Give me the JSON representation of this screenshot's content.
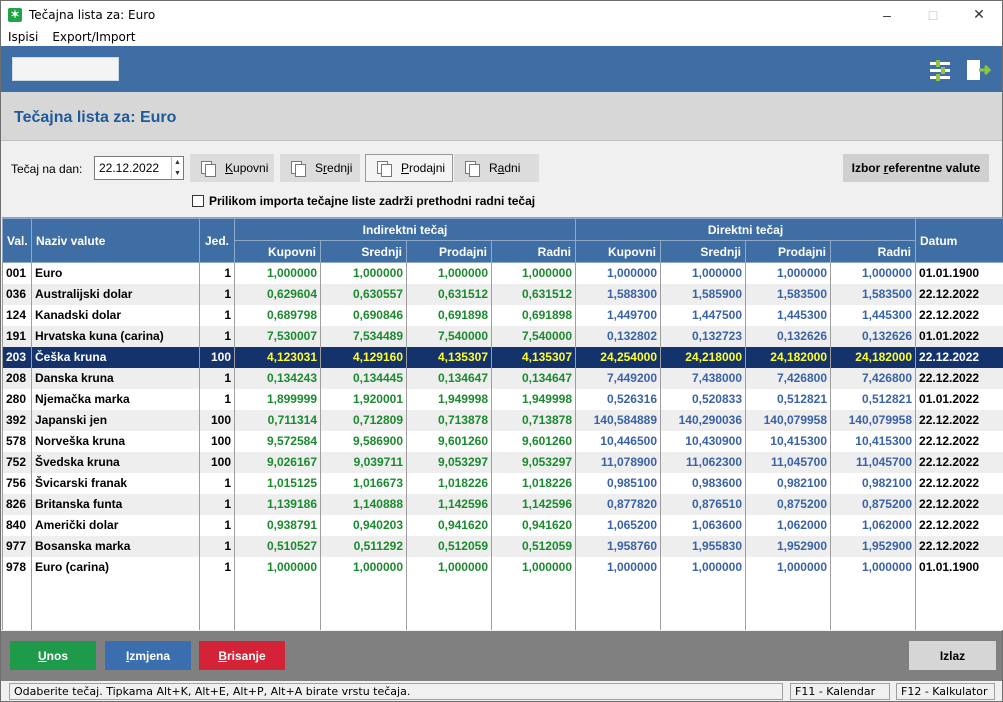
{
  "window": {
    "title": "Tečajna lista za: Euro"
  },
  "menu": [
    "Ispisi",
    "Export/Import"
  ],
  "page": {
    "title": "Tečajna lista za: Euro"
  },
  "controls": {
    "date_label": "Tečaj na dan:",
    "date_value": "22.12.2022",
    "rate_buttons": [
      {
        "pre": "",
        "u": "K",
        "post": "upovni"
      },
      {
        "pre": "S",
        "u": "r",
        "post": "ednji"
      },
      {
        "pre": "",
        "u": "P",
        "post": "rodajni"
      },
      {
        "pre": "R",
        "u": "a",
        "post": "dni"
      }
    ],
    "active_rate": "Prodajni",
    "ref_button": {
      "pre": "Izbor ",
      "u": "r",
      "post": "eferentne valute"
    },
    "checkbox_label": "Prilikom importa tečajne liste zadrži prethodni radni tečaj",
    "checkbox_checked": false
  },
  "table": {
    "headers": {
      "val": "Val.",
      "name": "Naziv valute",
      "jed": "Jed.",
      "indirect_group": "Indirektni tečaj",
      "direct_group": "Direktni tečaj",
      "datum": "Datum",
      "sub": [
        "Kupovni",
        "Srednji",
        "Prodajni",
        "Radni"
      ]
    },
    "selected_index": 4,
    "rows": [
      {
        "code": "001",
        "name": "Euro",
        "unit": "1",
        "ind": [
          "1,000000",
          "1,000000",
          "1,000000",
          "1,000000"
        ],
        "dir": [
          "1,000000",
          "1,000000",
          "1,000000",
          "1,000000"
        ],
        "date": "01.01.1900"
      },
      {
        "code": "036",
        "name": "Australijski dolar",
        "unit": "1",
        "ind": [
          "0,629604",
          "0,630557",
          "0,631512",
          "0,631512"
        ],
        "dir": [
          "1,588300",
          "1,585900",
          "1,583500",
          "1,583500"
        ],
        "date": "22.12.2022"
      },
      {
        "code": "124",
        "name": "Kanadski dolar",
        "unit": "1",
        "ind": [
          "0,689798",
          "0,690846",
          "0,691898",
          "0,691898"
        ],
        "dir": [
          "1,449700",
          "1,447500",
          "1,445300",
          "1,445300"
        ],
        "date": "22.12.2022"
      },
      {
        "code": "191",
        "name": "Hrvatska kuna (carina)",
        "unit": "1",
        "ind": [
          "7,530007",
          "7,534489",
          "7,540000",
          "7,540000"
        ],
        "dir": [
          "0,132802",
          "0,132723",
          "0,132626",
          "0,132626"
        ],
        "date": "01.01.2022"
      },
      {
        "code": "203",
        "name": "Češka kruna",
        "unit": "100",
        "ind": [
          "4,123031",
          "4,129160",
          "4,135307",
          "4,135307"
        ],
        "dir": [
          "24,254000",
          "24,218000",
          "24,182000",
          "24,182000"
        ],
        "date": "22.12.2022"
      },
      {
        "code": "208",
        "name": "Danska kruna",
        "unit": "1",
        "ind": [
          "0,134243",
          "0,134445",
          "0,134647",
          "0,134647"
        ],
        "dir": [
          "7,449200",
          "7,438000",
          "7,426800",
          "7,426800"
        ],
        "date": "22.12.2022"
      },
      {
        "code": "280",
        "name": "Njemačka marka",
        "unit": "1",
        "ind": [
          "1,899999",
          "1,920001",
          "1,949998",
          "1,949998"
        ],
        "dir": [
          "0,526316",
          "0,520833",
          "0,512821",
          "0,512821"
        ],
        "date": "01.01.2022"
      },
      {
        "code": "392",
        "name": "Japanski jen",
        "unit": "100",
        "ind": [
          "0,711314",
          "0,712809",
          "0,713878",
          "0,713878"
        ],
        "dir": [
          "140,584889",
          "140,290036",
          "140,079958",
          "140,079958"
        ],
        "date": "22.12.2022"
      },
      {
        "code": "578",
        "name": "Norveška kruna",
        "unit": "100",
        "ind": [
          "9,572584",
          "9,586900",
          "9,601260",
          "9,601260"
        ],
        "dir": [
          "10,446500",
          "10,430900",
          "10,415300",
          "10,415300"
        ],
        "date": "22.12.2022"
      },
      {
        "code": "752",
        "name": "Švedska kruna",
        "unit": "100",
        "ind": [
          "9,026167",
          "9,039711",
          "9,053297",
          "9,053297"
        ],
        "dir": [
          "11,078900",
          "11,062300",
          "11,045700",
          "11,045700"
        ],
        "date": "22.12.2022"
      },
      {
        "code": "756",
        "name": "Švicarski franak",
        "unit": "1",
        "ind": [
          "1,015125",
          "1,016673",
          "1,018226",
          "1,018226"
        ],
        "dir": [
          "0,985100",
          "0,983600",
          "0,982100",
          "0,982100"
        ],
        "date": "22.12.2022"
      },
      {
        "code": "826",
        "name": "Britanska funta",
        "unit": "1",
        "ind": [
          "1,139186",
          "1,140888",
          "1,142596",
          "1,142596"
        ],
        "dir": [
          "0,877820",
          "0,876510",
          "0,875200",
          "0,875200"
        ],
        "date": "22.12.2022"
      },
      {
        "code": "840",
        "name": "Američki dolar",
        "unit": "1",
        "ind": [
          "0,938791",
          "0,940203",
          "0,941620",
          "0,941620"
        ],
        "dir": [
          "1,065200",
          "1,063600",
          "1,062000",
          "1,062000"
        ],
        "date": "22.12.2022"
      },
      {
        "code": "977",
        "name": "Bosanska marka",
        "unit": "1",
        "ind": [
          "0,510527",
          "0,511292",
          "0,512059",
          "0,512059"
        ],
        "dir": [
          "1,958760",
          "1,955830",
          "1,952900",
          "1,952900"
        ],
        "date": "22.12.2022"
      },
      {
        "code": "978",
        "name": "Euro (carina)",
        "unit": "1",
        "ind": [
          "1,000000",
          "1,000000",
          "1,000000",
          "1,000000"
        ],
        "dir": [
          "1,000000",
          "1,000000",
          "1,000000",
          "1,000000"
        ],
        "date": "01.01.1900"
      }
    ]
  },
  "actions": {
    "unos": {
      "u": "U",
      "post": "nos"
    },
    "izmjena": {
      "u": "I",
      "post": "zmjena"
    },
    "brisanje": {
      "u": "B",
      "post": "risanje"
    },
    "izlaz": "Izlaz"
  },
  "status": {
    "hint": "Odaberite tečaj. Tipkama Alt+K, Alt+E, Alt+P, Alt+A birate vrstu tečaja.",
    "f11": "F11 - Kalendar",
    "f12": "F12 - Kalkulator"
  },
  "colors": {
    "toolbar": "#3f6ea5",
    "title": "#1f5a99",
    "indirect": "#1b8a2e",
    "direct": "#3a62a6",
    "selected_row": "#14336d",
    "selected_text": "#ffff30",
    "unos": "#1e9a4a",
    "izmjena": "#3a6eaf",
    "brisanje": "#d42237"
  },
  "icons": [
    "app-icon",
    "minimize-icon",
    "maximize-icon",
    "close-icon",
    "settings-icon",
    "exit-icon",
    "copy-icon",
    "checkbox-icon"
  ]
}
